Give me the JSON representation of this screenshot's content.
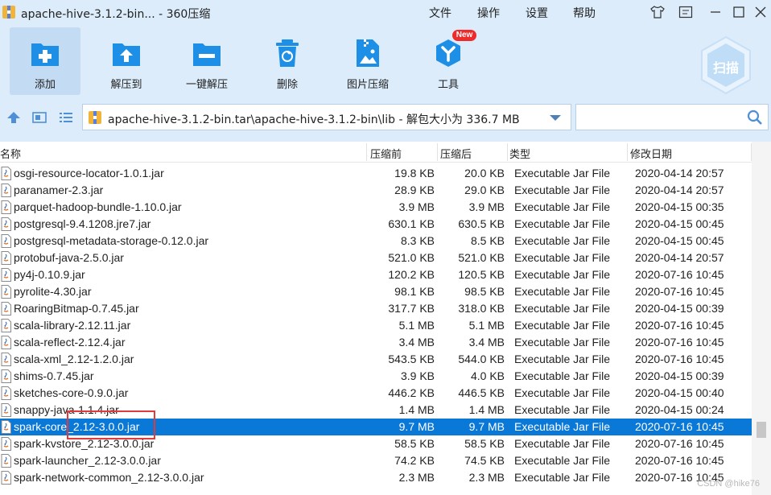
{
  "window": {
    "title": "apache-hive-3.1.2-bin... - 360压缩",
    "menu": [
      "文件",
      "操作",
      "设置",
      "帮助"
    ]
  },
  "toolbar": {
    "buttons": [
      {
        "label": "添加",
        "icon": "add-icon"
      },
      {
        "label": "解压到",
        "icon": "extract-to-icon"
      },
      {
        "label": "一键解压",
        "icon": "one-click-extract-icon"
      },
      {
        "label": "删除",
        "icon": "delete-icon"
      },
      {
        "label": "图片压缩",
        "icon": "image-compress-icon"
      },
      {
        "label": "工具",
        "icon": "tools-icon"
      }
    ],
    "new_badge": "New",
    "scan_label": "扫描"
  },
  "address": {
    "path": "apache-hive-3.1.2-bin.tar\\apache-hive-3.1.2-bin\\lib - 解包大小为 336.7 MB",
    "search_placeholder": ""
  },
  "columns": {
    "name": "名称",
    "compressed": "压缩前",
    "original": "压缩后",
    "type": "类型",
    "modified": "修改日期"
  },
  "files": [
    {
      "name": "osgi-resource-locator-1.0.1.jar",
      "compressed": "19.8 KB",
      "original": "20.0 KB",
      "type": "Executable Jar File",
      "date": "2020-04-14 20:57"
    },
    {
      "name": "paranamer-2.3.jar",
      "compressed": "28.9 KB",
      "original": "29.0 KB",
      "type": "Executable Jar File",
      "date": "2020-04-14 20:57"
    },
    {
      "name": "parquet-hadoop-bundle-1.10.0.jar",
      "compressed": "3.9 MB",
      "original": "3.9 MB",
      "type": "Executable Jar File",
      "date": "2020-04-15 00:35"
    },
    {
      "name": "postgresql-9.4.1208.jre7.jar",
      "compressed": "630.1 KB",
      "original": "630.5 KB",
      "type": "Executable Jar File",
      "date": "2020-04-15 00:45"
    },
    {
      "name": "postgresql-metadata-storage-0.12.0.jar",
      "compressed": "8.3 KB",
      "original": "8.5 KB",
      "type": "Executable Jar File",
      "date": "2020-04-15 00:45"
    },
    {
      "name": "protobuf-java-2.5.0.jar",
      "compressed": "521.0 KB",
      "original": "521.0 KB",
      "type": "Executable Jar File",
      "date": "2020-04-14 20:57"
    },
    {
      "name": "py4j-0.10.9.jar",
      "compressed": "120.2 KB",
      "original": "120.5 KB",
      "type": "Executable Jar File",
      "date": "2020-07-16 10:45"
    },
    {
      "name": "pyrolite-4.30.jar",
      "compressed": "98.1 KB",
      "original": "98.5 KB",
      "type": "Executable Jar File",
      "date": "2020-07-16 10:45"
    },
    {
      "name": "RoaringBitmap-0.7.45.jar",
      "compressed": "317.7 KB",
      "original": "318.0 KB",
      "type": "Executable Jar File",
      "date": "2020-04-15 00:39"
    },
    {
      "name": "scala-library-2.12.11.jar",
      "compressed": "5.1 MB",
      "original": "5.1 MB",
      "type": "Executable Jar File",
      "date": "2020-07-16 10:45"
    },
    {
      "name": "scala-reflect-2.12.4.jar",
      "compressed": "3.4 MB",
      "original": "3.4 MB",
      "type": "Executable Jar File",
      "date": "2020-07-16 10:45"
    },
    {
      "name": "scala-xml_2.12-1.2.0.jar",
      "compressed": "543.5 KB",
      "original": "544.0 KB",
      "type": "Executable Jar File",
      "date": "2020-07-16 10:45"
    },
    {
      "name": "shims-0.7.45.jar",
      "compressed": "3.9 KB",
      "original": "4.0 KB",
      "type": "Executable Jar File",
      "date": "2020-04-15 00:39"
    },
    {
      "name": "sketches-core-0.9.0.jar",
      "compressed": "446.2 KB",
      "original": "446.5 KB",
      "type": "Executable Jar File",
      "date": "2020-04-15 00:40"
    },
    {
      "name": "snappy-java-1.1.4.jar",
      "compressed": "1.4 MB",
      "original": "1.4 MB",
      "type": "Executable Jar File",
      "date": "2020-04-15 00:24"
    },
    {
      "name": "spark-core_2.12-3.0.0.jar",
      "compressed": "9.7 MB",
      "original": "9.7 MB",
      "type": "Executable Jar File",
      "date": "2020-07-16 10:45",
      "selected": true
    },
    {
      "name": "spark-kvstore_2.12-3.0.0.jar",
      "compressed": "58.5 KB",
      "original": "58.5 KB",
      "type": "Executable Jar File",
      "date": "2020-07-16 10:45"
    },
    {
      "name": "spark-launcher_2.12-3.0.0.jar",
      "compressed": "74.2 KB",
      "original": "74.5 KB",
      "type": "Executable Jar File",
      "date": "2020-07-16 10:45"
    },
    {
      "name": "spark-network-common_2.12-3.0.0.jar",
      "compressed": "2.3 MB",
      "original": "2.3 MB",
      "type": "Executable Jar File",
      "date": "2020-07-16 10:45"
    }
  ],
  "watermark": "CSDN @hike76",
  "colors": {
    "selection": "#0a78d7",
    "toolbar_icon": "#1d8fe6",
    "annotation_box": "#e23a3a"
  }
}
